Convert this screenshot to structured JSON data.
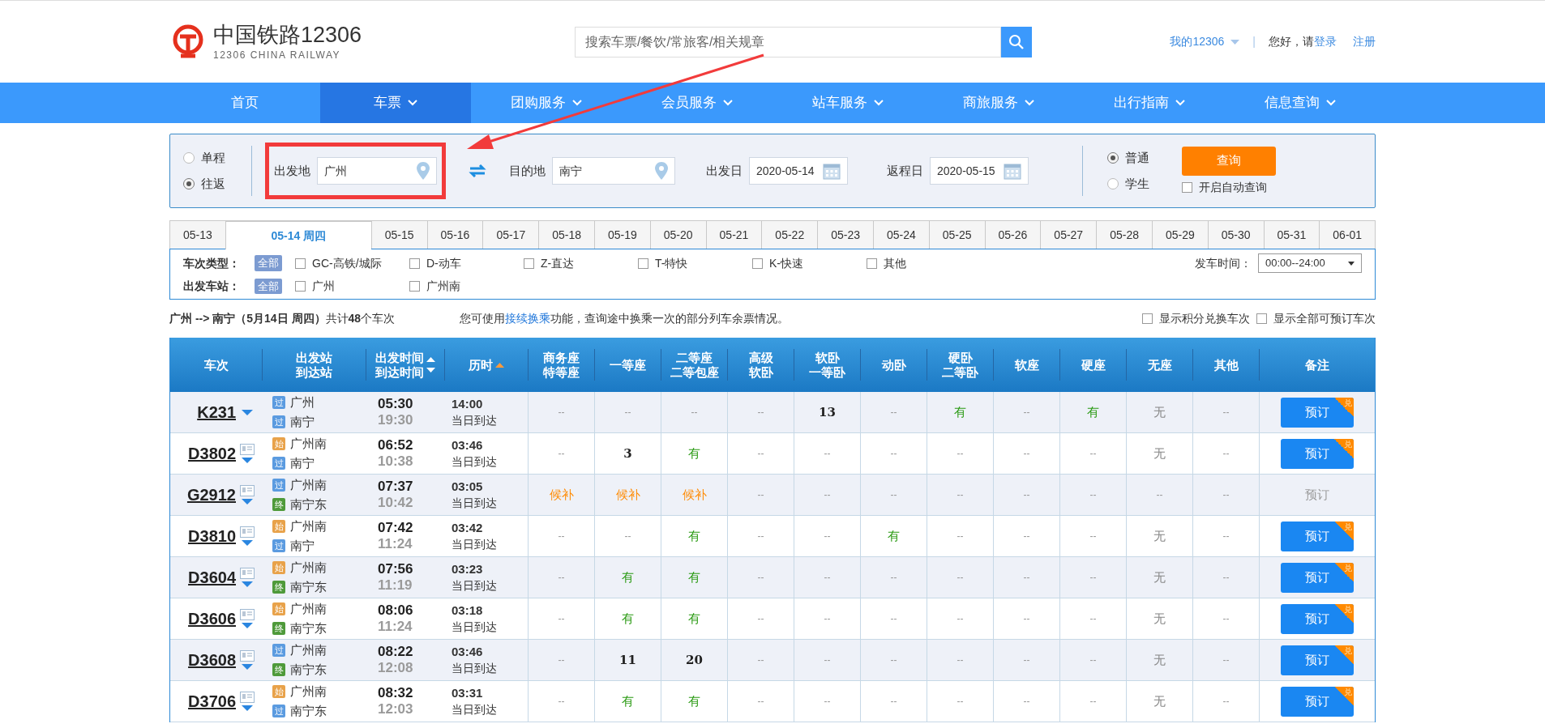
{
  "header": {
    "brand": "中国铁路12306",
    "brand_sub": "12306 CHINA RAILWAY",
    "search": {
      "placeholder": "搜索车票/餐饮/常旅客/相关规章"
    },
    "account": "我的12306",
    "separator": "|",
    "greeting": "您好，请",
    "login": "登录",
    "register": "注册"
  },
  "nav": [
    {
      "label": "首页",
      "selected": false,
      "dropdown": false
    },
    {
      "label": "车票",
      "selected": true,
      "dropdown": true
    },
    {
      "label": "团购服务",
      "selected": false,
      "dropdown": true
    },
    {
      "label": "会员服务",
      "selected": false,
      "dropdown": true
    },
    {
      "label": "站车服务",
      "selected": false,
      "dropdown": true
    },
    {
      "label": "商旅服务",
      "selected": false,
      "dropdown": true
    },
    {
      "label": "出行指南",
      "selected": false,
      "dropdown": true
    },
    {
      "label": "信息查询",
      "selected": false,
      "dropdown": true
    }
  ],
  "query": {
    "trip_types": [
      {
        "label": "单程",
        "selected": false
      },
      {
        "label": "往返",
        "selected": true
      }
    ],
    "from": {
      "label": "出发地",
      "value": "广州"
    },
    "to": {
      "label": "目的地",
      "value": "南宁"
    },
    "depart": {
      "label": "出发日",
      "value": "2020-05-14"
    },
    "return": {
      "label": "返程日",
      "value": "2020-05-15"
    },
    "passenger_types": [
      {
        "label": "普通",
        "selected": true
      },
      {
        "label": "学生",
        "selected": false
      }
    ],
    "submit": "查询",
    "auto_query": {
      "label": "开启自动查询",
      "checked": false
    }
  },
  "dates": [
    {
      "label": "05-13",
      "selected": false
    },
    {
      "label": "05-14 周四",
      "selected": true
    },
    {
      "label": "05-15",
      "selected": false
    },
    {
      "label": "05-16",
      "selected": false
    },
    {
      "label": "05-17",
      "selected": false
    },
    {
      "label": "05-18",
      "selected": false
    },
    {
      "label": "05-19",
      "selected": false
    },
    {
      "label": "05-20",
      "selected": false
    },
    {
      "label": "05-21",
      "selected": false
    },
    {
      "label": "05-22",
      "selected": false
    },
    {
      "label": "05-23",
      "selected": false
    },
    {
      "label": "05-24",
      "selected": false
    },
    {
      "label": "05-25",
      "selected": false
    },
    {
      "label": "05-26",
      "selected": false
    },
    {
      "label": "05-27",
      "selected": false
    },
    {
      "label": "05-28",
      "selected": false
    },
    {
      "label": "05-29",
      "selected": false
    },
    {
      "label": "05-30",
      "selected": false
    },
    {
      "label": "05-31",
      "selected": false
    },
    {
      "label": "06-01",
      "selected": false
    }
  ],
  "filters": {
    "train_type": {
      "label": "车次类型：",
      "all": {
        "label": "全部",
        "selected": true
      },
      "options": [
        {
          "label": "GC-高铁/城际",
          "checked": false
        },
        {
          "label": "D-动车",
          "checked": false
        },
        {
          "label": "Z-直达",
          "checked": false
        },
        {
          "label": "T-特快",
          "checked": false
        },
        {
          "label": "K-快速",
          "checked": false
        },
        {
          "label": "其他",
          "checked": false
        }
      ]
    },
    "station": {
      "label": "出发车站：",
      "all": {
        "label": "全部",
        "selected": true
      },
      "options": [
        {
          "label": "广州",
          "checked": false
        },
        {
          "label": "广州南",
          "checked": false
        }
      ]
    },
    "time": {
      "label": "发车时间：",
      "value": "00:00--24:00"
    }
  },
  "summary": {
    "text": "**广州 --> 南宁（5月14日 周四）**共计**48**个车次",
    "notice_before": "您可使用",
    "notice_link": "接续换乘",
    "notice_after": "功能，查询途中换乘一次的部分列车余票情况。",
    "options": [
      {
        "label": "显示积分兑换车次",
        "checked": false
      },
      {
        "label": "显示全部可预订车次",
        "checked": false
      }
    ]
  },
  "table": {
    "columns": [
      [
        "车次"
      ],
      [
        "出发站",
        "到达站"
      ],
      [
        "出发时间",
        "到达时间"
      ],
      [
        "历时"
      ],
      [
        "商务座",
        "特等座"
      ],
      [
        "一等座"
      ],
      [
        "二等座",
        "二等包座"
      ],
      [
        "高级",
        "软卧"
      ],
      [
        "软卧",
        "一等卧"
      ],
      [
        "动卧"
      ],
      [
        "硬卧",
        "二等卧"
      ],
      [
        "软座"
      ],
      [
        "硬座"
      ],
      [
        "无座"
      ],
      [
        "其他"
      ],
      [
        "备注"
      ]
    ],
    "rows": [
      {
        "train": "K231",
        "info_icon": false,
        "from": {
          "tag": "过",
          "kind": "pass",
          "name": "广州"
        },
        "to": {
          "tag": "过",
          "kind": "pass",
          "name": "南宁"
        },
        "depart": "05:30",
        "arrive": "19:30",
        "duration": "14:00",
        "arrival_day": "当日到达",
        "book": {
          "label": "预订",
          "enabled": true,
          "badge": "兑"
        },
        "seats": [
          {
            "text": "--",
            "kind": "dash"
          },
          {
            "text": "--",
            "kind": "dash"
          },
          {
            "text": "--",
            "kind": "dash"
          },
          {
            "text": "--",
            "kind": "dash"
          },
          {
            "text": "13",
            "kind": "number"
          },
          {
            "text": "--",
            "kind": "dash"
          },
          {
            "text": "有",
            "kind": "available"
          },
          {
            "text": "--",
            "kind": "dash"
          },
          {
            "text": "有",
            "kind": "available"
          },
          {
            "text": "无",
            "kind": "none"
          },
          {
            "text": "--",
            "kind": "dash"
          }
        ]
      },
      {
        "train": "D3802",
        "info_icon": true,
        "from": {
          "tag": "始",
          "kind": "start",
          "name": "广州南"
        },
        "to": {
          "tag": "过",
          "kind": "pass",
          "name": "南宁"
        },
        "depart": "06:52",
        "arrive": "10:38",
        "duration": "03:46",
        "arrival_day": "当日到达",
        "book": {
          "label": "预订",
          "enabled": true,
          "badge": "兑"
        },
        "seats": [
          {
            "text": "--",
            "kind": "dash"
          },
          {
            "text": "3",
            "kind": "number"
          },
          {
            "text": "有",
            "kind": "available"
          },
          {
            "text": "--",
            "kind": "dash"
          },
          {
            "text": "--",
            "kind": "dash"
          },
          {
            "text": "--",
            "kind": "dash"
          },
          {
            "text": "--",
            "kind": "dash"
          },
          {
            "text": "--",
            "kind": "dash"
          },
          {
            "text": "--",
            "kind": "dash"
          },
          {
            "text": "无",
            "kind": "none"
          },
          {
            "text": "--",
            "kind": "dash"
          }
        ]
      },
      {
        "train": "G2912",
        "info_icon": true,
        "from": {
          "tag": "过",
          "kind": "pass",
          "name": "广州南"
        },
        "to": {
          "tag": "终",
          "kind": "end",
          "name": "南宁东"
        },
        "depart": "07:37",
        "arrive": "10:42",
        "duration": "03:05",
        "arrival_day": "当日到达",
        "book": {
          "label": "预订",
          "enabled": false
        },
        "seats": [
          {
            "text": "候补",
            "kind": "waitlist"
          },
          {
            "text": "候补",
            "kind": "waitlist"
          },
          {
            "text": "候补",
            "kind": "waitlist"
          },
          {
            "text": "--",
            "kind": "dash"
          },
          {
            "text": "--",
            "kind": "dash"
          },
          {
            "text": "--",
            "kind": "dash"
          },
          {
            "text": "--",
            "kind": "dash"
          },
          {
            "text": "--",
            "kind": "dash"
          },
          {
            "text": "--",
            "kind": "dash"
          },
          {
            "text": "--",
            "kind": "dash"
          },
          {
            "text": "--",
            "kind": "dash"
          }
        ]
      },
      {
        "train": "D3810",
        "info_icon": true,
        "from": {
          "tag": "始",
          "kind": "start",
          "name": "广州南"
        },
        "to": {
          "tag": "过",
          "kind": "pass",
          "name": "南宁"
        },
        "depart": "07:42",
        "arrive": "11:24",
        "duration": "03:42",
        "arrival_day": "当日到达",
        "book": {
          "label": "预订",
          "enabled": true,
          "badge": "兑"
        },
        "seats": [
          {
            "text": "--",
            "kind": "dash"
          },
          {
            "text": "--",
            "kind": "dash"
          },
          {
            "text": "有",
            "kind": "available"
          },
          {
            "text": "--",
            "kind": "dash"
          },
          {
            "text": "--",
            "kind": "dash"
          },
          {
            "text": "有",
            "kind": "available"
          },
          {
            "text": "--",
            "kind": "dash"
          },
          {
            "text": "--",
            "kind": "dash"
          },
          {
            "text": "--",
            "kind": "dash"
          },
          {
            "text": "无",
            "kind": "none"
          },
          {
            "text": "--",
            "kind": "dash"
          }
        ]
      },
      {
        "train": "D3604",
        "info_icon": true,
        "from": {
          "tag": "始",
          "kind": "start",
          "name": "广州南"
        },
        "to": {
          "tag": "终",
          "kind": "end",
          "name": "南宁东"
        },
        "depart": "07:56",
        "arrive": "11:19",
        "duration": "03:23",
        "arrival_day": "当日到达",
        "book": {
          "label": "预订",
          "enabled": true,
          "badge": "兑"
        },
        "seats": [
          {
            "text": "--",
            "kind": "dash"
          },
          {
            "text": "有",
            "kind": "available"
          },
          {
            "text": "有",
            "kind": "available"
          },
          {
            "text": "--",
            "kind": "dash"
          },
          {
            "text": "--",
            "kind": "dash"
          },
          {
            "text": "--",
            "kind": "dash"
          },
          {
            "text": "--",
            "kind": "dash"
          },
          {
            "text": "--",
            "kind": "dash"
          },
          {
            "text": "--",
            "kind": "dash"
          },
          {
            "text": "无",
            "kind": "none"
          },
          {
            "text": "--",
            "kind": "dash"
          }
        ]
      },
      {
        "train": "D3606",
        "info_icon": true,
        "from": {
          "tag": "始",
          "kind": "start",
          "name": "广州南"
        },
        "to": {
          "tag": "终",
          "kind": "end",
          "name": "南宁东"
        },
        "depart": "08:06",
        "arrive": "11:24",
        "duration": "03:18",
        "arrival_day": "当日到达",
        "book": {
          "label": "预订",
          "enabled": true,
          "badge": "兑"
        },
        "seats": [
          {
            "text": "--",
            "kind": "dash"
          },
          {
            "text": "有",
            "kind": "available"
          },
          {
            "text": "有",
            "kind": "available"
          },
          {
            "text": "--",
            "kind": "dash"
          },
          {
            "text": "--",
            "kind": "dash"
          },
          {
            "text": "--",
            "kind": "dash"
          },
          {
            "text": "--",
            "kind": "dash"
          },
          {
            "text": "--",
            "kind": "dash"
          },
          {
            "text": "--",
            "kind": "dash"
          },
          {
            "text": "无",
            "kind": "none"
          },
          {
            "text": "--",
            "kind": "dash"
          }
        ]
      },
      {
        "train": "D3608",
        "info_icon": true,
        "from": {
          "tag": "过",
          "kind": "pass",
          "name": "广州南"
        },
        "to": {
          "tag": "终",
          "kind": "end",
          "name": "南宁东"
        },
        "depart": "08:22",
        "arrive": "12:08",
        "duration": "03:46",
        "arrival_day": "当日到达",
        "book": {
          "label": "预订",
          "enabled": true,
          "badge": "兑"
        },
        "seats": [
          {
            "text": "--",
            "kind": "dash"
          },
          {
            "text": "11",
            "kind": "number"
          },
          {
            "text": "20",
            "kind": "number"
          },
          {
            "text": "--",
            "kind": "dash"
          },
          {
            "text": "--",
            "kind": "dash"
          },
          {
            "text": "--",
            "kind": "dash"
          },
          {
            "text": "--",
            "kind": "dash"
          },
          {
            "text": "--",
            "kind": "dash"
          },
          {
            "text": "--",
            "kind": "dash"
          },
          {
            "text": "无",
            "kind": "none"
          },
          {
            "text": "--",
            "kind": "dash"
          }
        ]
      },
      {
        "train": "D3706",
        "info_icon": true,
        "from": {
          "tag": "始",
          "kind": "start",
          "name": "广州南"
        },
        "to": {
          "tag": "过",
          "kind": "pass",
          "name": "南宁东"
        },
        "depart": "08:32",
        "arrive": "12:03",
        "duration": "03:31",
        "arrival_day": "当日到达",
        "book": {
          "label": "预订",
          "enabled": true,
          "badge": "兑"
        },
        "seats": [
          {
            "text": "--",
            "kind": "dash"
          },
          {
            "text": "有",
            "kind": "available"
          },
          {
            "text": "有",
            "kind": "available"
          },
          {
            "text": "--",
            "kind": "dash"
          },
          {
            "text": "--",
            "kind": "dash"
          },
          {
            "text": "--",
            "kind": "dash"
          },
          {
            "text": "--",
            "kind": "dash"
          },
          {
            "text": "--",
            "kind": "dash"
          },
          {
            "text": "--",
            "kind": "dash"
          },
          {
            "text": "无",
            "kind": "none"
          },
          {
            "text": "--",
            "kind": "dash"
          }
        ]
      }
    ]
  }
}
